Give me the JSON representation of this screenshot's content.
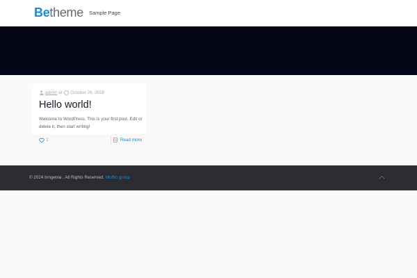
{
  "header": {
    "logo_bold": "Be",
    "logo_rest": "theme",
    "nav": [
      {
        "label": "Sample Page"
      }
    ]
  },
  "post": {
    "author": "admin",
    "at_word": "at",
    "date": "October 26, 2018",
    "title": "Hello world!",
    "excerpt": "Welcome to WordPress. This is your first post. Edit or delete it, then start writing!",
    "likes": "2",
    "read_more": "Read more"
  },
  "footer": {
    "copyright": "© 2024 Inngenia . All Rights Reserved.",
    "credit": "Muffin group"
  },
  "icons": {
    "author": "user-icon",
    "date": "clock-icon",
    "like": "heart-icon",
    "read_more": "document-icon",
    "back_to_top": "chevron-up-icon"
  },
  "colors": {
    "accent": "#1a8bd0",
    "subheader": "#040517",
    "footer": "#2a2c31"
  }
}
